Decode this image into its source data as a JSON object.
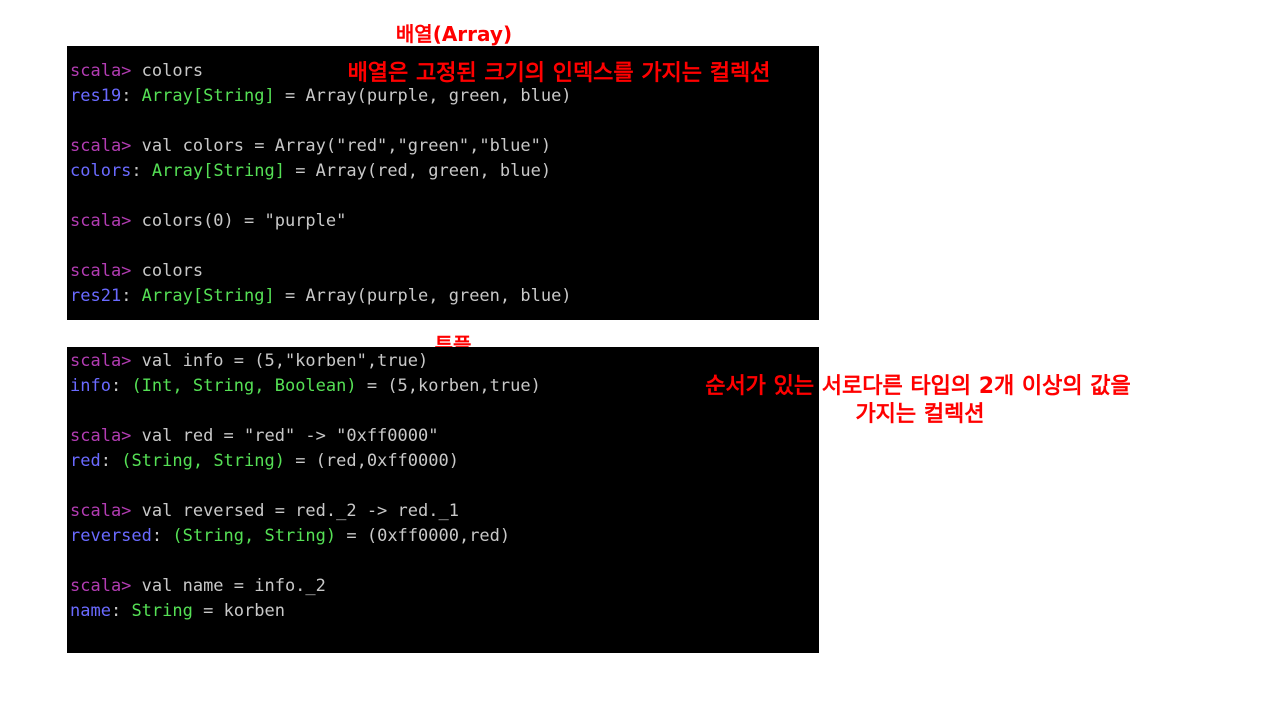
{
  "array_section": {
    "title": "배열(Array)",
    "description": "배열은 고정된 크기의 인덱스를 가지는 컬렉션",
    "lines": [
      {
        "prompt": "scala> ",
        "command": "colors"
      },
      {
        "name": "res19",
        "sep": ": ",
        "type": "Array[String]",
        "value": " = Array(purple, green, blue)"
      },
      {
        "blank": true
      },
      {
        "prompt": "scala> ",
        "command": "val colors = Array(\"red\",\"green\",\"blue\")"
      },
      {
        "name": "colors",
        "sep": ": ",
        "type": "Array[String]",
        "value": " = Array(red, green, blue)"
      },
      {
        "blank": true
      },
      {
        "prompt": "scala> ",
        "command": "colors(0) = \"purple\""
      },
      {
        "blank": true
      },
      {
        "prompt": "scala> ",
        "command": "colors"
      },
      {
        "name": "res21",
        "sep": ": ",
        "type": "Array[String]",
        "value": " = Array(purple, green, blue)"
      }
    ]
  },
  "tuple_section": {
    "title": "튜플",
    "description_line1": "순서가 있는 서로다른 타입의 2개 이상의 값을",
    "description_line2": "가지는 컬렉션",
    "lines": [
      {
        "prompt": "scala> ",
        "command": "val info = (5,\"korben\",true)"
      },
      {
        "name": "info",
        "sep": ": ",
        "type": "(Int, String, Boolean)",
        "value": " = (5,korben,true)"
      },
      {
        "blank": true
      },
      {
        "prompt": "scala> ",
        "command": "val red = \"red\" -> \"0xff0000\""
      },
      {
        "name": "red",
        "sep": ": ",
        "type": "(String, String)",
        "value": " = (red,0xff0000)"
      },
      {
        "blank": true
      },
      {
        "prompt": "scala> ",
        "command": "val reversed = red._2 -> red._1"
      },
      {
        "name": "reversed",
        "sep": ": ",
        "type": "(String, String)",
        "value": " = (0xff0000,red)"
      },
      {
        "blank": true
      },
      {
        "prompt": "scala> ",
        "command": "val name = info._2"
      },
      {
        "name": "name",
        "sep": ": ",
        "type": "String",
        "value": " = korben"
      }
    ]
  }
}
